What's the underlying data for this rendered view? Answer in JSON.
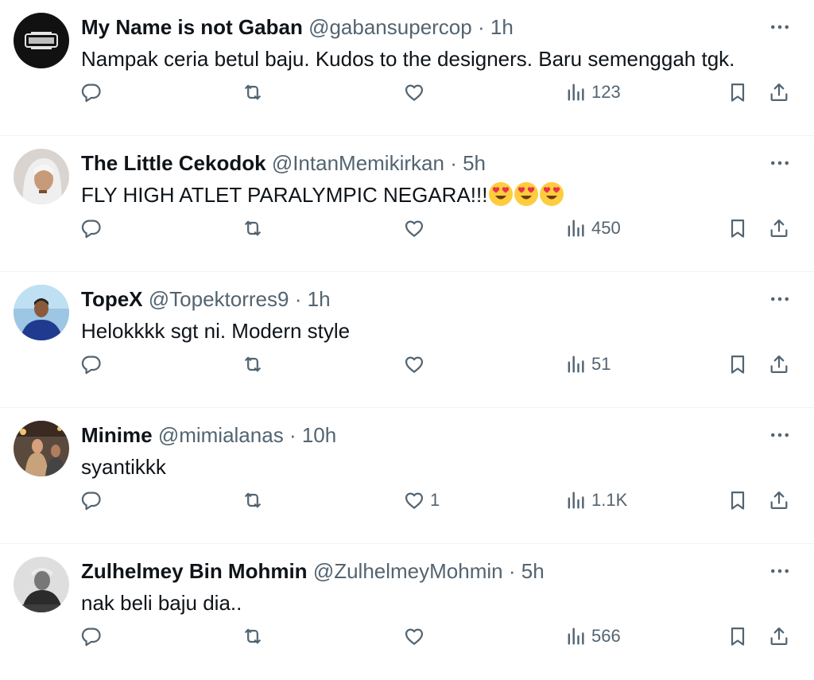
{
  "tweets": [
    {
      "name": "My Name is not Gaban",
      "handle": "@gabansupercop",
      "separator": "·",
      "time": "1h",
      "text": "Nampak ceria betul baju. Kudos to the designers.  Baru semenggah tgk.",
      "emojis": [],
      "reply_count": "",
      "retweet_count": "",
      "like_count": "",
      "views": "123",
      "avatar": {
        "bg": "#111111",
        "style": "logo"
      }
    },
    {
      "name": "The Little Cekodok",
      "handle": "@IntanMemikirkan",
      "separator": "·",
      "time": "5h",
      "text": "FLY HIGH ATLET PARALYMPIC NEGARA!!!",
      "emojis": [
        "heart-eyes-emoji",
        "heart-eyes-emoji",
        "heart-eyes-emoji"
      ],
      "reply_count": "",
      "retweet_count": "",
      "like_count": "",
      "views": "450",
      "avatar": {
        "bg": "#d9d4cf",
        "style": "hijab"
      }
    },
    {
      "name": "TopeX",
      "handle": "@Topektorres9",
      "separator": "·",
      "time": "1h",
      "text": "Helokkkk sgt ni. Modern style",
      "emojis": [],
      "reply_count": "",
      "retweet_count": "",
      "like_count": "",
      "views": "51",
      "avatar": {
        "bg": "#9cc6e4",
        "style": "person-blue"
      }
    },
    {
      "name": "Minime",
      "handle": "@mimialanas",
      "separator": "·",
      "time": "10h",
      "text": "syantikkk",
      "emojis": [],
      "reply_count": "",
      "retweet_count": "",
      "like_count": "1",
      "views": "1.1K",
      "avatar": {
        "bg": "#5a4a3e",
        "style": "night"
      }
    },
    {
      "name": "Zulhelmey Bin Mohmin",
      "handle": "@ZulhelmeyMohmin",
      "separator": "·",
      "time": "5h",
      "text": "nak beli baju dia..",
      "emojis": [],
      "reply_count": "",
      "retweet_count": "",
      "like_count": "",
      "views": "566",
      "avatar": {
        "bg": "#dedede",
        "style": "bw"
      }
    }
  ],
  "colors": {
    "text": "#0f1419",
    "secondary": "#536471",
    "divider": "#eff3f4"
  },
  "icons": [
    "reply-icon",
    "retweet-icon",
    "like-icon",
    "views-icon",
    "bookmark-icon",
    "share-icon",
    "more-icon"
  ]
}
